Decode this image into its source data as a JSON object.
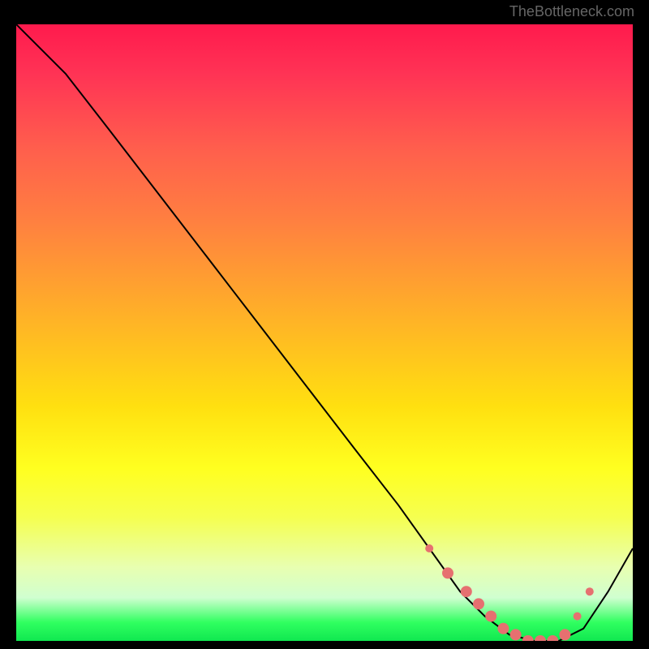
{
  "watermark": "TheBottleneck.com",
  "chart_data": {
    "type": "line",
    "title": "",
    "xlabel": "",
    "ylabel": "",
    "xlim": [
      0,
      100
    ],
    "ylim": [
      0,
      100
    ],
    "series": [
      {
        "name": "curve",
        "x": [
          0,
          8,
          15,
          25,
          35,
          45,
          55,
          62,
          67,
          72,
          76,
          80,
          84,
          88,
          92,
          96,
          100
        ],
        "values": [
          100,
          92,
          83,
          70,
          57,
          44,
          31,
          22,
          15,
          8,
          4,
          1,
          0,
          0,
          2,
          8,
          15
        ]
      }
    ],
    "markers": {
      "name": "bottom-cluster",
      "x": [
        67,
        70,
        73,
        75,
        77,
        79,
        81,
        83,
        85,
        87,
        89,
        91,
        93
      ],
      "values": [
        15,
        11,
        8,
        6,
        4,
        2,
        1,
        0,
        0,
        0,
        1,
        4,
        8
      ],
      "color": "#e67070",
      "size_large": 7,
      "size_small": 5
    }
  }
}
